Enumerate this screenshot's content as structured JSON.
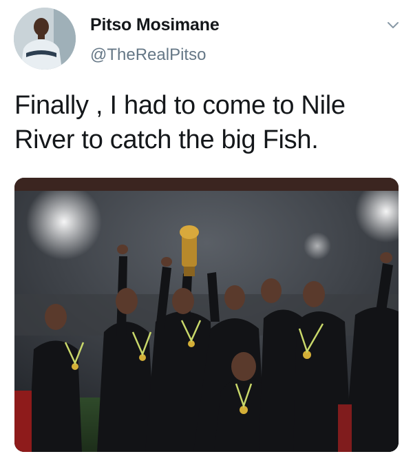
{
  "tweet": {
    "author": {
      "name": "Pitso Mosimane",
      "handle": "@TheRealPitso",
      "avatar_icon": "profile-photo"
    },
    "text_line_1": "Finally , I had to come to Nile",
    "text_line_2": "River to catch the big Fish.",
    "menu_icon": "chevron-down-icon",
    "media": {
      "kind": "photo",
      "subject": "team celebrating with trophy"
    }
  },
  "colors": {
    "text": "#14171a",
    "secondary": "#657786",
    "background": "#ffffff"
  }
}
